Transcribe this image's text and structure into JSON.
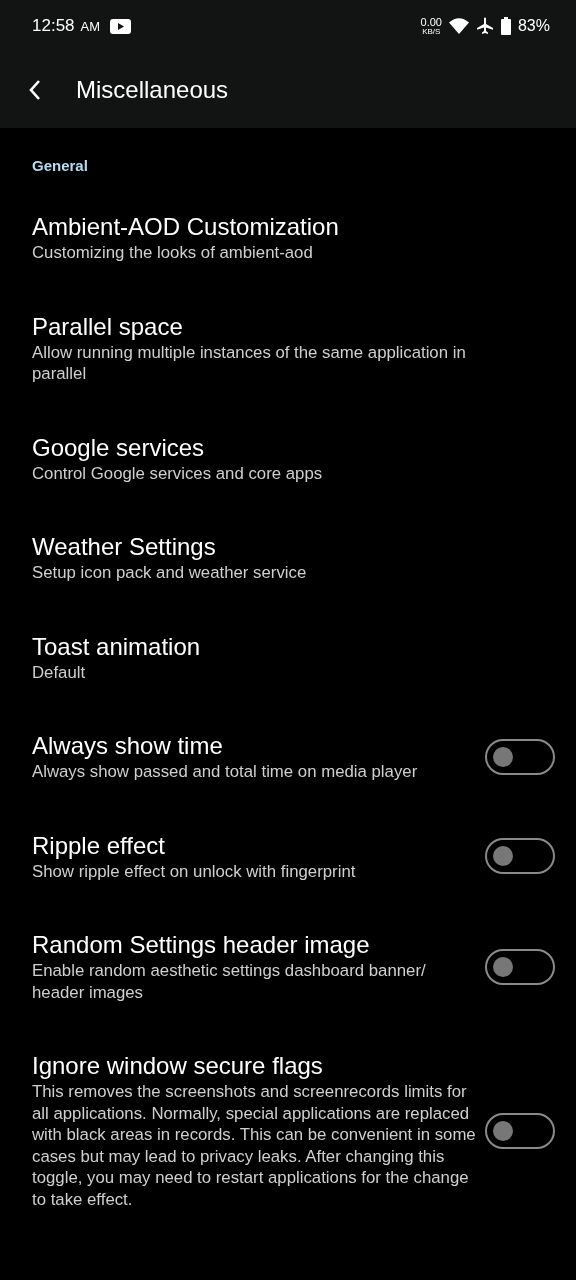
{
  "status_bar": {
    "time": "12:58",
    "meridiem": "AM",
    "net_speed": "0.00",
    "net_unit": "KB/S",
    "battery": "83%"
  },
  "app_bar": {
    "title": "Miscellaneous"
  },
  "section": {
    "title": "General"
  },
  "items": [
    {
      "kind": "link",
      "title": "Ambient-AOD Customization",
      "summary": "Customizing the looks of ambient-aod"
    },
    {
      "kind": "link",
      "title": "Parallel space",
      "summary": "Allow running multiple instances of the same application in parallel"
    },
    {
      "kind": "link",
      "title": "Google services",
      "summary": "Control Google services and core apps"
    },
    {
      "kind": "link",
      "title": "Weather Settings",
      "summary": "Setup icon pack and weather service"
    },
    {
      "kind": "link",
      "title": "Toast animation",
      "summary": "Default"
    },
    {
      "kind": "toggle",
      "title": "Always show time",
      "summary": "Always show passed and total time on media player",
      "on": false
    },
    {
      "kind": "toggle",
      "title": "Ripple effect",
      "summary": "Show ripple effect on unlock with fingerprint",
      "on": false
    },
    {
      "kind": "toggle",
      "title": "Random Settings header image",
      "summary": "Enable random aesthetic settings dashboard banner/ header images",
      "on": false
    },
    {
      "kind": "toggle",
      "title": "Ignore window secure flags",
      "summary": "This removes the screenshots and screenrecords limits for all applications. Normally, special applications are replaced with black areas in records. This can be convenient in some cases but may lead to privacy leaks. After changing this toggle, you may need to restart applications for the change to take effect.",
      "on": false
    }
  ]
}
